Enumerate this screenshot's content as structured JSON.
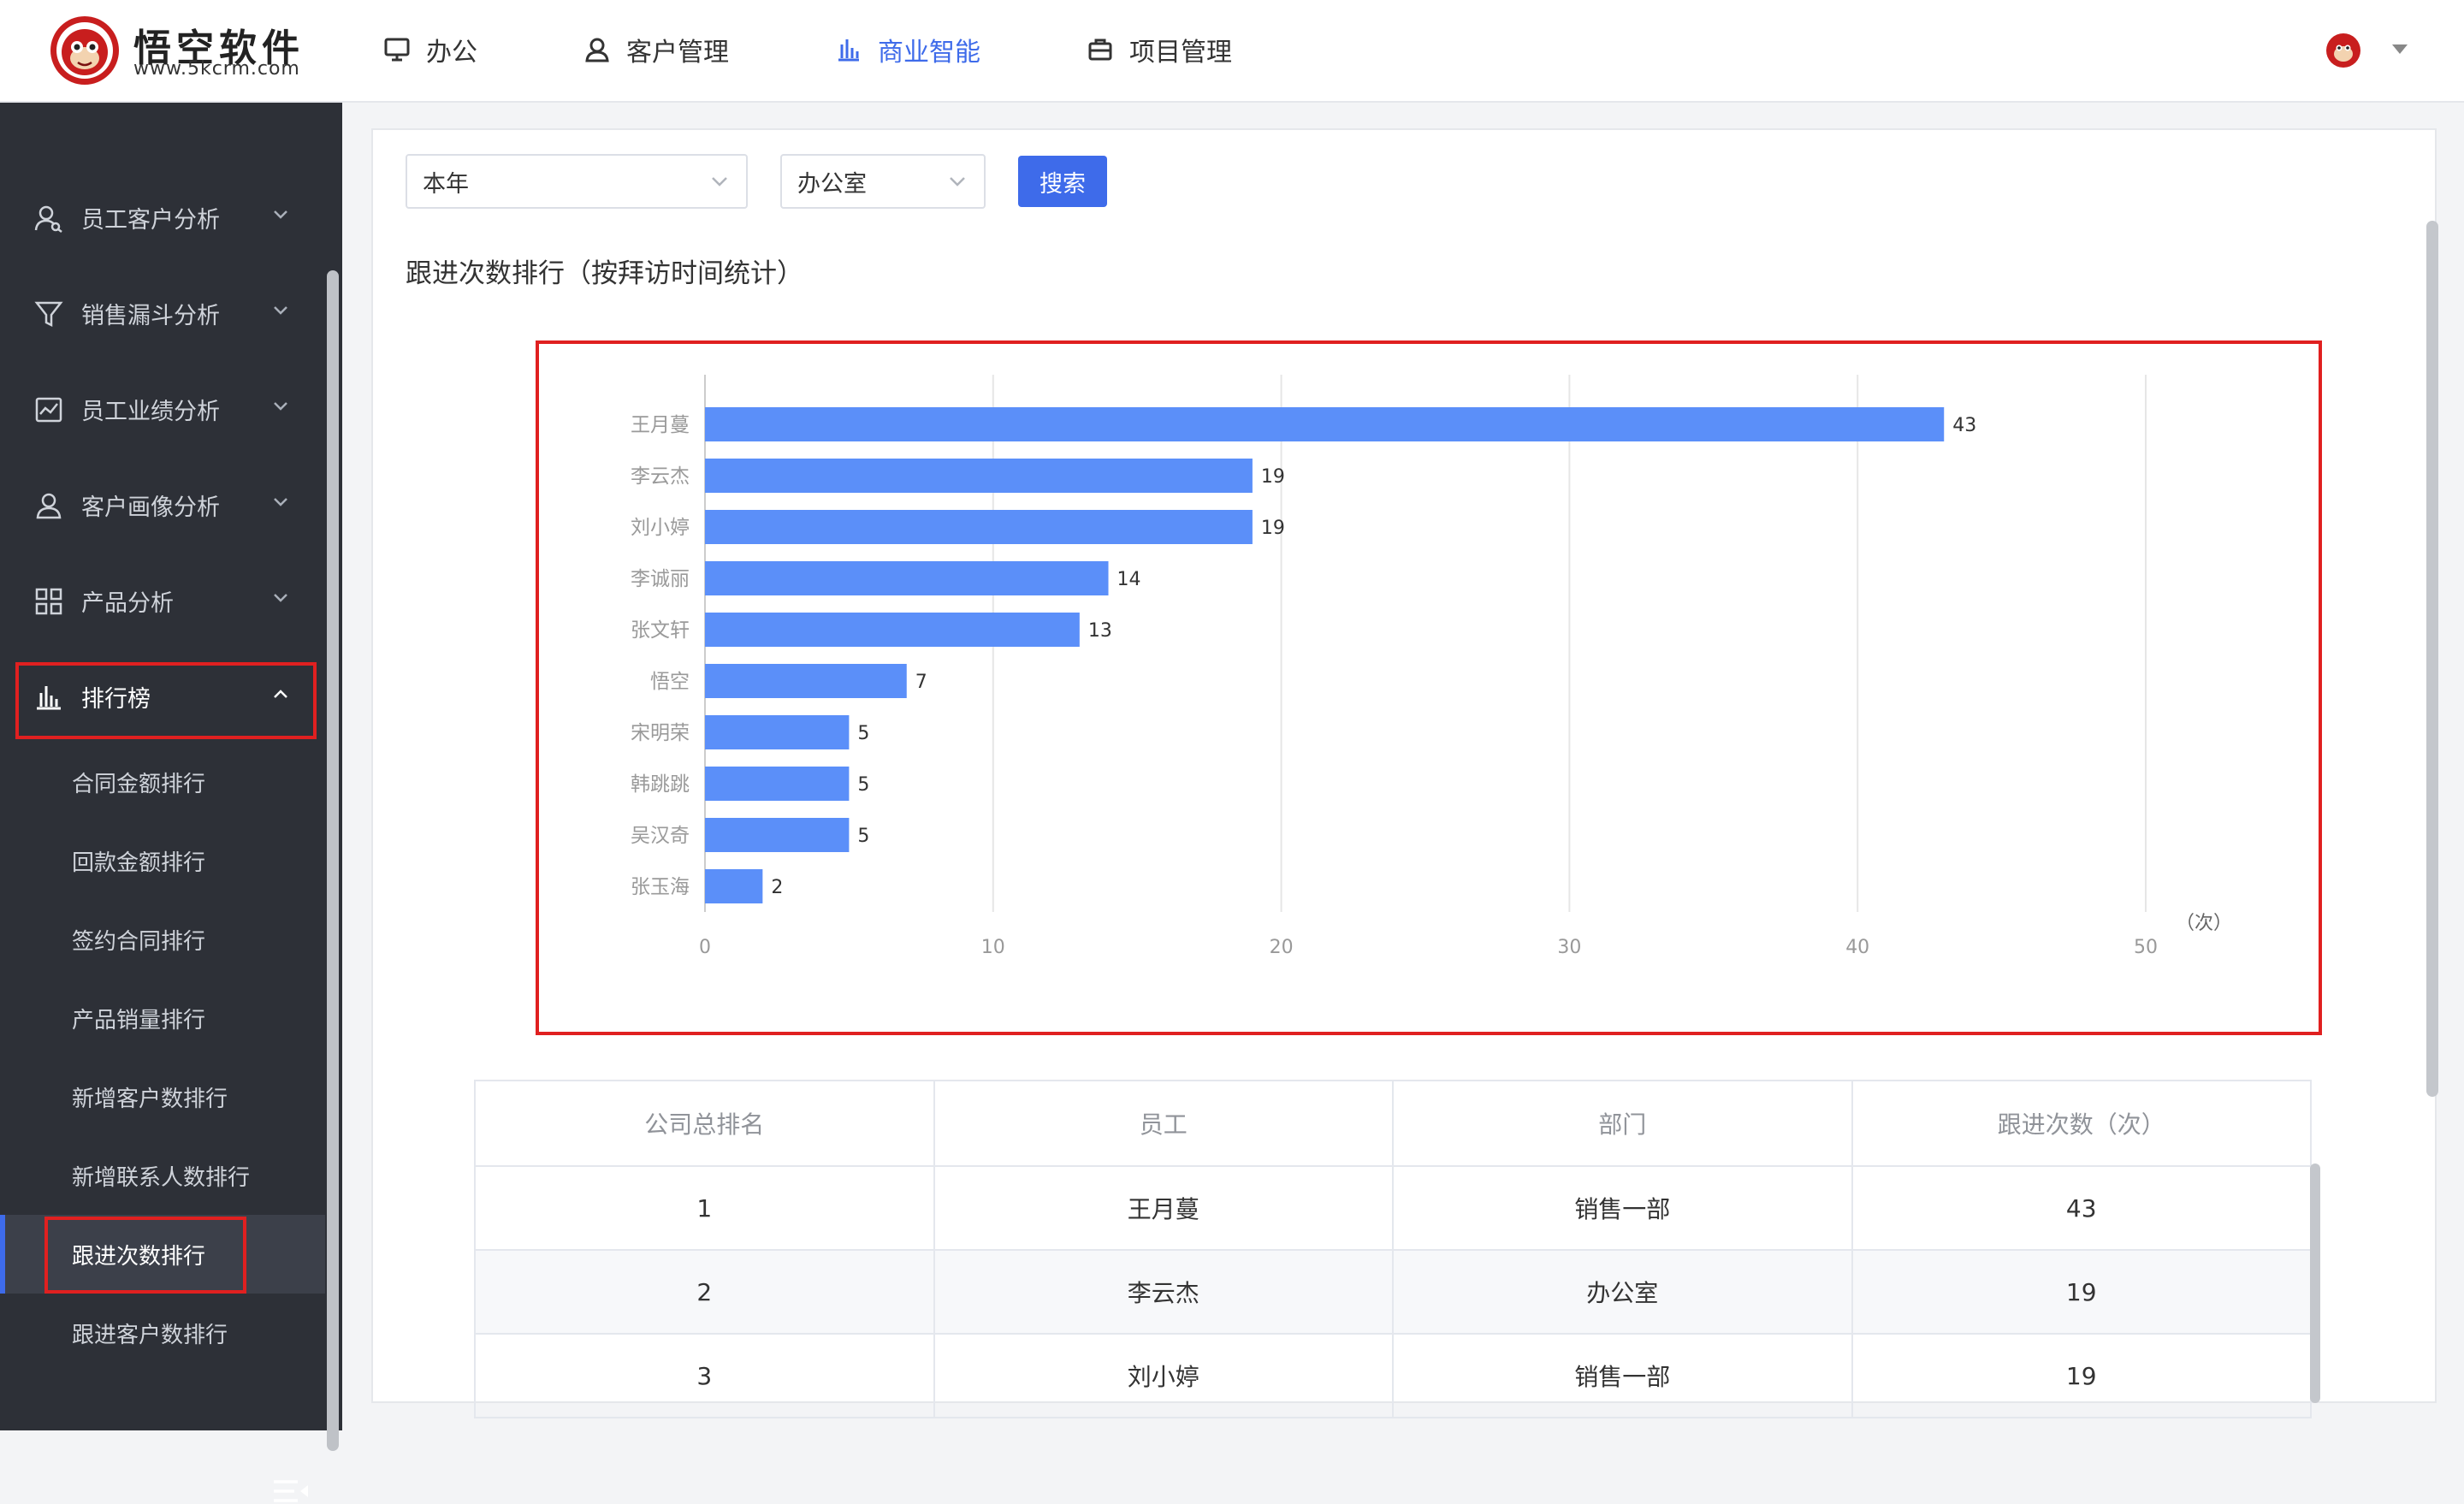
{
  "brand": {
    "title": "悟空软件",
    "url": "www.5kcrm.com"
  },
  "nav": [
    {
      "label": "办公",
      "icon": "monitor-icon",
      "active": false
    },
    {
      "label": "客户管理",
      "icon": "user-icon",
      "active": false
    },
    {
      "label": "商业智能",
      "icon": "bar-chart-icon",
      "active": true
    },
    {
      "label": "项目管理",
      "icon": "briefcase-icon",
      "active": false
    }
  ],
  "sidebar": {
    "menus": [
      {
        "label": "员工客户分析",
        "icon": "user-search-icon"
      },
      {
        "label": "销售漏斗分析",
        "icon": "funnel-icon"
      },
      {
        "label": "员工业绩分析",
        "icon": "trend-chart-icon"
      },
      {
        "label": "客户画像分析",
        "icon": "user-icon"
      },
      {
        "label": "产品分析",
        "icon": "grid-icon"
      },
      {
        "label": "排行榜",
        "icon": "bar-chart-icon",
        "open": true
      }
    ],
    "submenus": [
      {
        "label": "合同金额排行"
      },
      {
        "label": "回款金额排行"
      },
      {
        "label": "签约合同排行"
      },
      {
        "label": "产品销量排行"
      },
      {
        "label": "新增客户数排行"
      },
      {
        "label": "新增联系人数排行"
      },
      {
        "label": "跟进次数排行",
        "active": true
      },
      {
        "label": "跟进客户数排行"
      }
    ]
  },
  "filters": {
    "period": "本年",
    "department": "办公室",
    "search_label": "搜索"
  },
  "chart_title": "跟进次数排行（按拜访时间统计）",
  "chart_data": {
    "type": "bar",
    "orientation": "horizontal",
    "categories": [
      "王月蔓",
      "李云杰",
      "刘小婷",
      "李诚丽",
      "张文轩",
      "悟空",
      "宋明荣",
      "韩跳跳",
      "吴汉奇",
      "张玉海"
    ],
    "values": [
      43,
      19,
      19,
      14,
      13,
      7,
      5,
      5,
      5,
      2
    ],
    "xlim": [
      0,
      50
    ],
    "xticks": [
      0,
      10,
      20,
      30,
      40,
      50
    ],
    "xunit": "（次）",
    "grid": true,
    "bar_color": "#5b8ff9"
  },
  "table": {
    "headers": [
      "公司总排名",
      "员工",
      "部门",
      "跟进次数（次）"
    ],
    "rows": [
      [
        "1",
        "王月蔓",
        "销售一部",
        "43"
      ],
      [
        "2",
        "李云杰",
        "办公室",
        "19"
      ],
      [
        "3",
        "刘小婷",
        "销售一部",
        "19"
      ]
    ]
  },
  "colors": {
    "accent": "#3e6bea",
    "sidebar": "#2d3037",
    "highlight": "#e02020"
  }
}
